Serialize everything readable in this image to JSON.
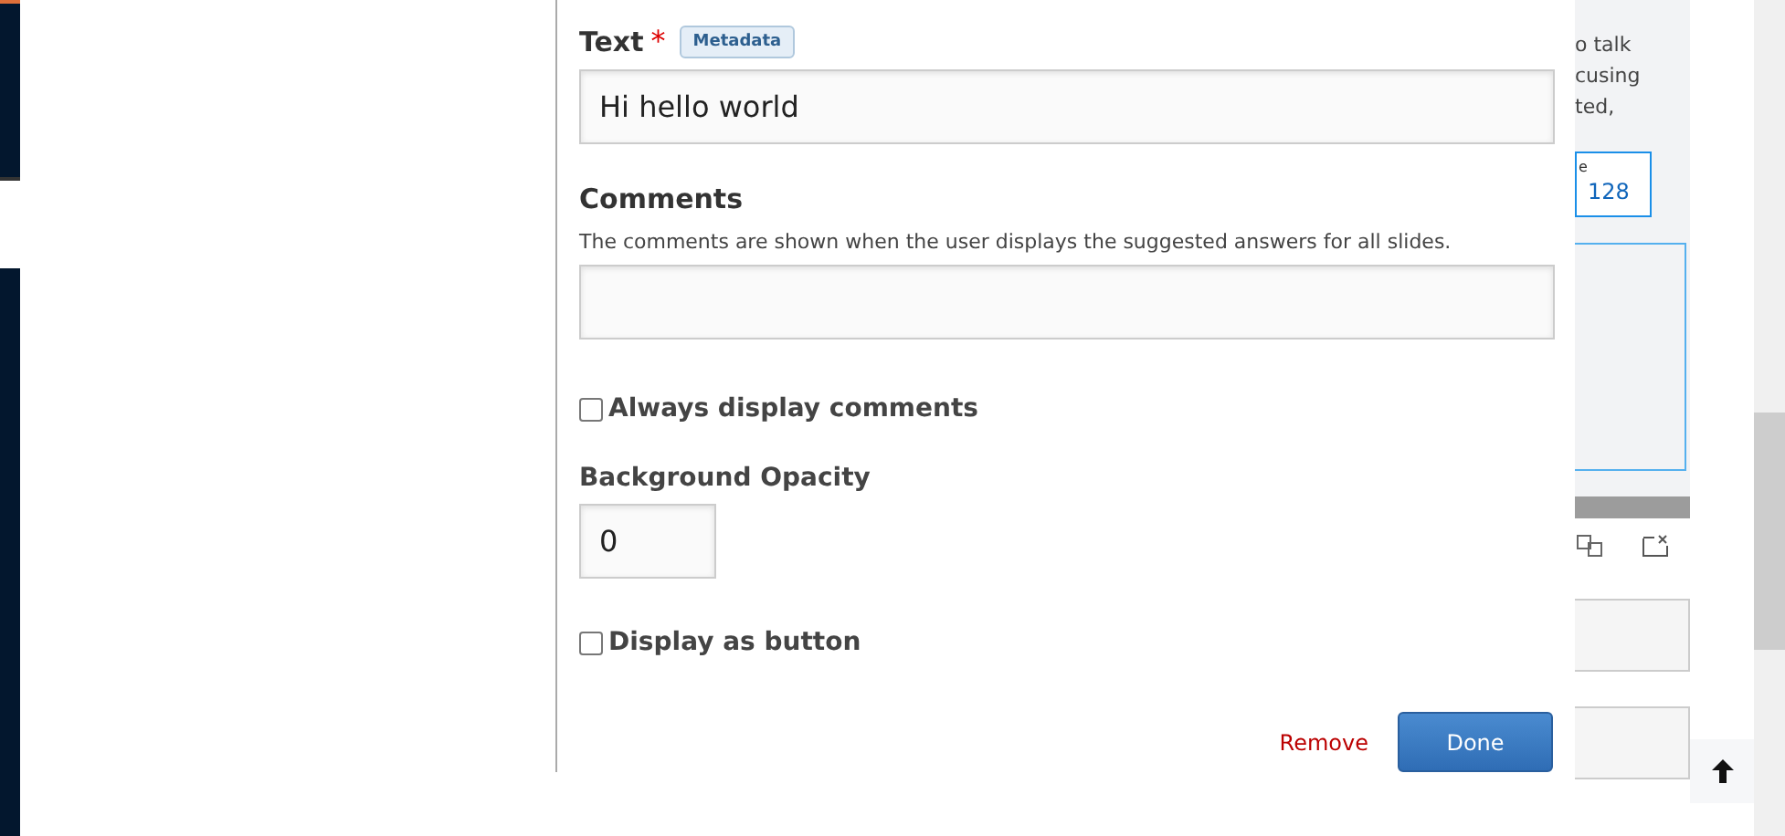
{
  "dialog": {
    "text_field": {
      "label": "Text",
      "required_mark": "*",
      "tag": "Metadata",
      "value": "Hi hello world"
    },
    "comments": {
      "label": "Comments",
      "help": "The comments are shown when the user displays the suggested answers for all slides."
    },
    "checkboxes": [
      {
        "label": "Always display comments",
        "checked": false
      }
    ],
    "opacity": {
      "label": "Background Opacity",
      "value": "0"
    },
    "checkboxes_2": [
      {
        "label": "Display as button",
        "checked": false
      }
    ],
    "remove": "Remove",
    "done": "Done"
  },
  "background_panel": {
    "text_lines": [
      "o talk",
      "cusing",
      "ted,"
    ],
    "box_label": "e",
    "box_value": "128"
  }
}
